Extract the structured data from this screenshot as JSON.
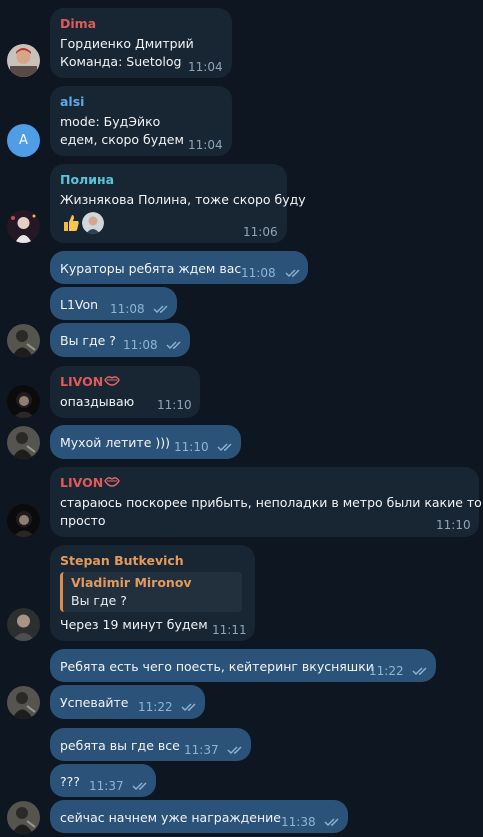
{
  "colors": {
    "background": "#0e1621",
    "bubble_in": "#182533",
    "bubble_out": "#2b5278",
    "name_dima": "#e05a5a",
    "name_alsi": "#5cabe8",
    "name_polina": "#59c6d8",
    "name_livon": "#e05a5a",
    "name_stepan": "#e39a5c"
  },
  "messages": [
    {
      "sender": "Dima",
      "lines": [
        "Гордиенко Дмитрий",
        "Команда: Suetolog"
      ],
      "time": "11:04"
    },
    {
      "sender": "alsi",
      "avatar_letter": "A",
      "lines": [
        "mode: БудЭйко",
        "едем, скоро будем"
      ],
      "time": "11:04"
    },
    {
      "sender": "Полина",
      "lines": [
        "Жизнякова Полина, тоже скоро буду"
      ],
      "time": "11:06",
      "reactions": [
        "thumbs-up-emoji",
        "user-reaction-avatar"
      ]
    },
    {
      "text": "Кураторы ребята ждем вас",
      "time": "11:08"
    },
    {
      "text": "L1Von",
      "time": "11:08"
    },
    {
      "text": "Вы где ?",
      "time": "11:08"
    },
    {
      "sender": "LIVON",
      "text": "опаздываю",
      "time": "11:10"
    },
    {
      "text": "Мухой летите )))",
      "time": "11:10"
    },
    {
      "sender": "LIVON",
      "lines": [
        "стараюсь поскорее прибыть, неполадки в метро были какие то",
        "просто"
      ],
      "time": "11:10"
    },
    {
      "sender": "Stepan Butkevich",
      "reply_to": {
        "sender": "Vladimir Mironov",
        "text": "Вы где ?"
      },
      "text": "Через 19 минут будем",
      "time": "11:11"
    },
    {
      "text": "Ребята есть чего поесть, кейтеринг вкусняшки",
      "time": "11:22"
    },
    {
      "text": "Успевайте",
      "time": "11:22"
    },
    {
      "text": "ребята вы где все",
      "time": "11:37"
    },
    {
      "text": "???",
      "time": "11:37"
    },
    {
      "text": "сейчас начнем уже награждение",
      "time": "11:38"
    }
  ]
}
